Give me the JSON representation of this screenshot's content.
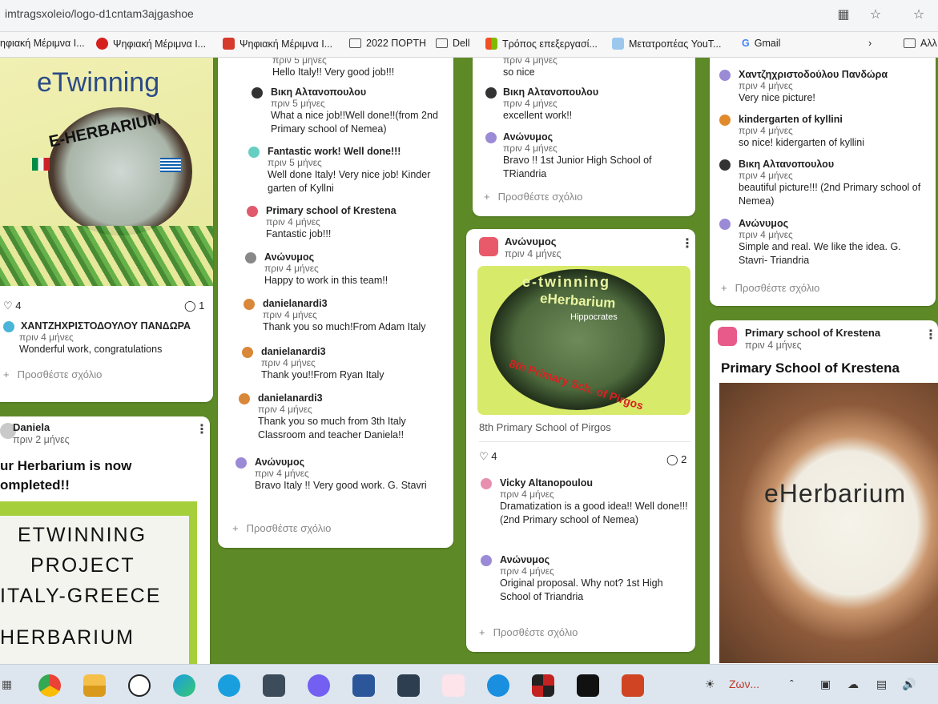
{
  "browser": {
    "url": "imtragsxoleio/logo-d1cntam3ajgashoe",
    "bookmarks": [
      {
        "label": "ηφιακή Μέριμνα Ι...",
        "color": "#3a6fd8"
      },
      {
        "label": "Ψηφιακή Μέριμνα Ι...",
        "color": "#d62020"
      },
      {
        "label": "Ψηφιακή Μέριμνα Ι...",
        "color": "#d63a2a"
      },
      {
        "label": "2022 ΠΟΡΤΗ",
        "color": "folder"
      },
      {
        "label": "Dell",
        "color": "folder"
      },
      {
        "label": "Τρόπος επεξεργασί...",
        "color": "#f25022"
      },
      {
        "label": "Μετατροπέας YouT...",
        "color": "#4a90d9"
      },
      {
        "label": "Gmail",
        "color": "#4285f4"
      },
      {
        "label": "Αλλ",
        "color": "folder"
      }
    ]
  },
  "col1": {
    "top_card": {
      "image_title": "eTwinning",
      "image_subtitle": "E-HERBARIUM",
      "likes": "4",
      "comments": "1",
      "comment": {
        "author": "ΧΑΝΤΖΗΧΡΙΣΤΟΔΟΥΛΟΥ ΠΑΝΔΩΡΑ",
        "time": "πριν 4 μήνες",
        "text": "Wonderful work, congratulations"
      },
      "add_comment": "Προσθέστε σχόλιο"
    },
    "bottom_card": {
      "author": "Daniela",
      "time": "πριν 2 μήνες",
      "title_line1": "ur Herbarium is now",
      "title_line2": "ompleted!!",
      "image_lines": [
        "ETWINNING",
        "PROJECT",
        "ITALY-GREECE",
        "HERBARIUM"
      ]
    }
  },
  "col2": {
    "comments": [
      {
        "author": "",
        "time": "πριν 5 μήνες",
        "text": "Hello Italy!! Very good job!!!"
      },
      {
        "author": "Βικη Αλτανοπουλου",
        "time": "πριν 5 μήνες",
        "text": "What a nice job!!Well done!!(from 2nd Primary school of Nemea)"
      },
      {
        "author": "Fantastic work! Well done!!!",
        "time": "πριν 5 μήνες",
        "text": "Well done Italy! Very nice job! Kinder garten of Kyllni"
      },
      {
        "author": "Primary school of Krestena",
        "time": "πριν 4 μήνες",
        "text": "Fantastic job!!!"
      },
      {
        "author": "Ανώνυμος",
        "time": "πριν 4 μήνες",
        "text": "Happy to work in this team!!"
      },
      {
        "author": "danielanardi3",
        "time": "πριν 4 μήνες",
        "text": "Thank you so much!From Adam Italy"
      },
      {
        "author": "danielanardi3",
        "time": "πριν 4 μήνες",
        "text": "Thank you!!From Ryan Italy"
      },
      {
        "author": "danielanardi3",
        "time": "πριν 4 μήνες",
        "text": "Thank you so much from 3th Italy Classroom and teacher Daniela!!"
      },
      {
        "author": "Ανώνυμος",
        "time": "πριν 4 μήνες",
        "text": "Bravo Italy !! Very good work. G. Stavri"
      }
    ],
    "add_comment": "Προσθέστε σχόλιο"
  },
  "col3": {
    "top_card": {
      "comments": [
        {
          "author": "",
          "time": "πριν 4 μήνες",
          "text": "so nice"
        },
        {
          "author": "Βικη Αλτανοπουλου",
          "time": "πριν 4 μήνες",
          "text": "excellent work!!"
        },
        {
          "author": "Ανώνυμος",
          "time": "πριν 4 μήνες",
          "text": "Bravo !! 1st Junior High School of TRiandria"
        }
      ],
      "add_comment": "Προσθέστε σχόλιο"
    },
    "post": {
      "author": "Ανώνυμος",
      "time": "πριν 4 μήνες",
      "image_title1": "e-twinning",
      "image_title2": "eHerbarium",
      "image_small": "Hippocrates",
      "image_bottom": "8th Primary Sch. of Pirgos",
      "caption": "8th Primary School of Pirgos",
      "likes": "4",
      "comments_count": "2",
      "comments": [
        {
          "author": "Vicky Altanopoulou",
          "time": "πριν 4 μήνες",
          "text": "Dramatization is a good idea!! Well done!!! (2nd Primary school of Nemea)"
        },
        {
          "author": "Ανώνυμος",
          "time": "πριν 4 μήνες",
          "text": "Original proposal. Why not? 1st High School of Triandria"
        }
      ],
      "add_comment": "Προσθέστε σχόλιο"
    }
  },
  "col4": {
    "top_card": {
      "comments": [
        {
          "author": "Χαντζηχριστοδούλου Πανδώρα",
          "time": "πριν 4 μήνες",
          "text": "Very nice picture!"
        },
        {
          "author": "kindergarten of kyllini",
          "time": "πριν 4 μήνες",
          "text": "so nice! kidergarten of kyllini"
        },
        {
          "author": "Βικη Αλτανοπουλου",
          "time": "πριν 4 μήνες",
          "text": "beautiful picture!!! (2nd Primary school of Nemea)"
        },
        {
          "author": "Ανώνυμος",
          "time": "πριν 4 μήνες",
          "text": "Simple and real. We like the idea. G. Stavri- Triandria"
        }
      ],
      "add_comment": "Προσθέστε σχόλιο"
    },
    "post": {
      "author": "Primary school of Krestena",
      "time": "πριν 4 μήνες",
      "title": "Primary School of Krestena",
      "image_text": "eHerbarium"
    }
  },
  "taskbar": {
    "weather_text": "Ζων..."
  }
}
